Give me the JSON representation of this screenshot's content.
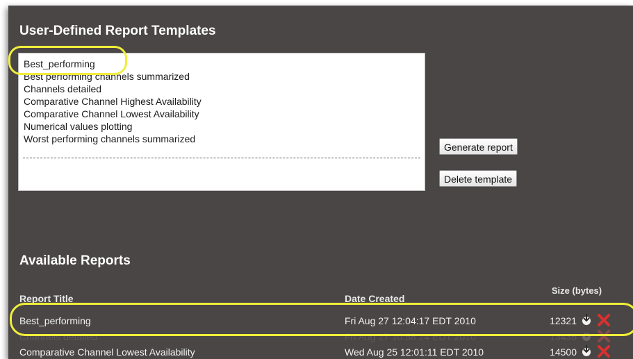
{
  "templates": {
    "title": "User-Defined Report Templates",
    "items": [
      "Best_performing",
      "Best performing channels summarized",
      "Channels detailed",
      "Comparative Channel Highest Availability",
      "Comparative Channel Lowest Availability",
      "Numerical values plotting",
      "Worst performing channels summarized"
    ],
    "separator": "----------------------------------------------------------------------------------------------",
    "generate_label": "Generate report",
    "delete_label": "Delete template"
  },
  "reports": {
    "title": "Available Reports",
    "columns": {
      "title": "Report Title",
      "date": "Date Created",
      "size": "Size (bytes)"
    },
    "rows": [
      {
        "title": "Best_performing",
        "date": "Fri Aug 27 12:04:17 EDT 2010",
        "size": "12321"
      },
      {
        "title": "Channels detailed",
        "date": "Fri Aug 27 10:58:24 EDT 2010",
        "size": "13436"
      },
      {
        "title": "Comparative Channel Lowest Availability",
        "date": "Wed Aug 25 12:01:11 EDT 2010",
        "size": "14500"
      }
    ]
  },
  "icons": {
    "download": "download-icon",
    "delete": "delete-x-icon"
  },
  "colors": {
    "highlight": "#f0ee3a",
    "panel": "#4a4645",
    "delete": "#d93030"
  }
}
